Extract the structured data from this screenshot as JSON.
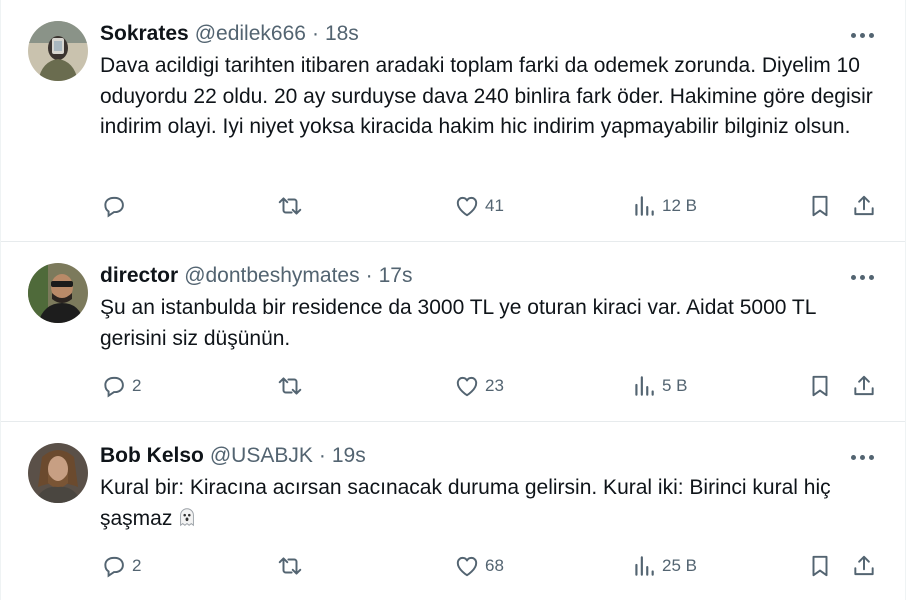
{
  "tweets": [
    {
      "name": "Sokrates",
      "handle": "@edilek666",
      "separator": "·",
      "time": "18s",
      "text": "Dava acildigi tarihten itibaren aradaki toplam farki da odemek zorunda. Diyelim 10 oduyordu 22 oldu. 20 ay surduyse dava 240 binlira fark öder. Hakimine göre degisir indirim olayi. Iyi niyet yoksa kiracida hakim hic indirim yapmayabilir bilginiz olsun.",
      "replies": "",
      "retweets": "",
      "likes": "41",
      "views": "12 B"
    },
    {
      "name": "director",
      "handle": "@dontbeshymates",
      "separator": "·",
      "time": "17s",
      "text": "Şu an istanbulda bir residence da 3000 TL ye oturan kiraci var. Aidat 5000 TL gerisini siz düşünün.",
      "replies": "2",
      "retweets": "",
      "likes": "23",
      "views": "5 B"
    },
    {
      "name": "Bob Kelso",
      "handle": "@USABJK",
      "separator": "·",
      "time": "19s",
      "text": "Kural bir: Kiracına acırsan sacınacak duruma gelirsin. Kural iki: Birinci kural hiç şaşmaz",
      "replies": "2",
      "retweets": "",
      "likes": "68",
      "views": "25 B"
    }
  ],
  "icons": {
    "reply": "reply-icon",
    "retweet": "retweet-icon",
    "like": "heart-icon",
    "views": "views-icon",
    "bookmark": "bookmark-icon",
    "share": "share-icon",
    "more": "more-icon",
    "emoji": "ghost-emoji-icon"
  },
  "colors": {
    "text": "#0f1419",
    "secondary": "#536471",
    "divider": "#e7ebed"
  }
}
